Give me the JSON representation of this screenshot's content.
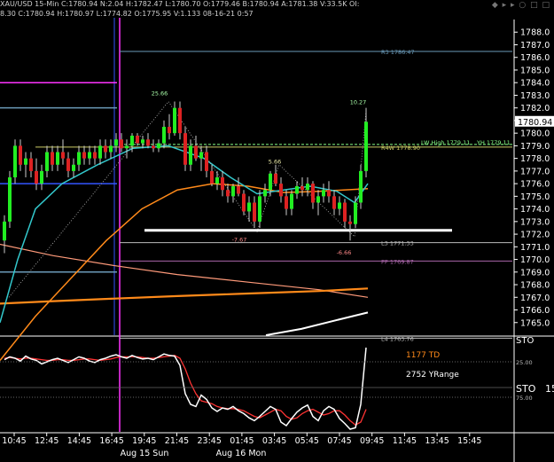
{
  "header": {
    "line1": "XAU/USD  15-Min  C:1780.94  N:2.04  H:1782.47  L:1780.70  O:1779.46  B:1780.94  A:1781.38  V:33.5K  OI:",
    "line2": "8.30  C:1780.94  H:1780.97  L:1774.82  O:1775.95  V:1.133  08-16-21  0:57"
  },
  "toolbar_glyphs": "◆ ▸ ▸ ○ □ □",
  "colors": {
    "bg": "#000000",
    "axis": "#ffffff",
    "grid": "#444444",
    "bull": "#22ee22",
    "bear": "#dd2222",
    "wick": "#cccccc",
    "cyan": "#33c8cc",
    "orange": "#ff8a1a",
    "salmon": "#ff9a7a",
    "magenta": "#ff33ff",
    "blue": "#3355ff",
    "white": "#ffffff",
    "steelblue": "#6a9ab8",
    "violet": "#aa66aa",
    "red": "#ff3333"
  },
  "chart_data": {
    "type": "candlestick",
    "price_axis": {
      "min": 1764.0,
      "max": 1789.0,
      "ticks": [
        1788.0,
        1787.0,
        1786.0,
        1785.0,
        1784.0,
        1783.0,
        1782.0,
        1781.0,
        1780.0,
        1779.0,
        1778.0,
        1777.0,
        1776.0,
        1775.0,
        1774.0,
        1773.0,
        1772.0,
        1771.0,
        1770.0,
        1769.0,
        1768.0,
        1767.0,
        1766.0,
        1765.0
      ],
      "current_price": "1780.94"
    },
    "time_axis": [
      "10:45",
      "12:45",
      "14:45",
      "16:45",
      "19:45",
      "21:45",
      "23:45",
      "01:45",
      "03:45",
      "05:45",
      "07:45",
      "09:45",
      "11:45",
      "13:45",
      "15:45"
    ],
    "date_labels": [
      "Aug 15 Sun",
      "Aug 16 Mon"
    ],
    "pivot_levels": [
      {
        "label": "R3 1786.47",
        "price": 1786.47
      },
      {
        "label": "R4W 1778.90",
        "price": 1778.9
      },
      {
        "label": "LW High 1779.11",
        "price": 1779.11
      },
      {
        "label": "YH 1779.11",
        "price": 1779.11
      },
      {
        "label": "L3 1771.33",
        "price": 1771.33
      },
      {
        "label": "PP 1769.87",
        "price": 1769.87
      },
      {
        "label": "L4 1763.76",
        "price": 1763.76
      }
    ],
    "swing_labels": [
      {
        "text": "25.66",
        "price": 1783.0
      },
      {
        "text": "10.27",
        "price": 1782.3
      },
      {
        "text": "5.66",
        "price": 1777.6
      },
      {
        "text": "-7.67",
        "price": 1771.4
      },
      {
        "text": "-6.66",
        "price": 1770.4
      }
    ],
    "candles": [
      [
        1771.5,
        1773.5,
        1770.5,
        1773.0
      ],
      [
        1773.0,
        1777.0,
        1772.5,
        1776.5
      ],
      [
        1776.5,
        1779.5,
        1776.0,
        1779.0
      ],
      [
        1779.0,
        1779.5,
        1777.0,
        1777.5
      ],
      [
        1777.5,
        1778.5,
        1776.5,
        1778.0
      ],
      [
        1778.0,
        1778.5,
        1776.5,
        1777.0
      ],
      [
        1777.0,
        1778.0,
        1775.5,
        1776.0
      ],
      [
        1776.0,
        1777.5,
        1775.5,
        1777.0
      ],
      [
        1777.0,
        1779.0,
        1776.5,
        1778.5
      ],
      [
        1778.5,
        1779.0,
        1777.0,
        1777.5
      ],
      [
        1777.5,
        1779.0,
        1777.0,
        1778.5
      ],
      [
        1778.5,
        1779.5,
        1777.5,
        1778.0
      ],
      [
        1778.0,
        1778.5,
        1776.5,
        1777.0
      ],
      [
        1777.0,
        1778.0,
        1776.5,
        1777.5
      ],
      [
        1777.5,
        1779.0,
        1777.0,
        1778.5
      ],
      [
        1778.5,
        1779.0,
        1777.5,
        1778.0
      ],
      [
        1778.0,
        1779.0,
        1777.5,
        1778.5
      ],
      [
        1778.5,
        1779.0,
        1777.5,
        1778.0
      ],
      [
        1778.0,
        1779.5,
        1777.5,
        1779.0
      ],
      [
        1779.0,
        1779.5,
        1778.0,
        1778.5
      ],
      [
        1778.5,
        1779.5,
        1778.0,
        1779.0
      ],
      [
        1779.0,
        1780.0,
        1778.5,
        1779.5
      ],
      [
        1779.5,
        1780.0,
        1778.5,
        1778.8
      ],
      [
        1778.8,
        1779.5,
        1778.0,
        1779.0
      ],
      [
        1779.0,
        1780.0,
        1778.5,
        1779.8
      ],
      [
        1779.8,
        1780.0,
        1779.0,
        1779.2
      ],
      [
        1779.2,
        1779.8,
        1778.8,
        1779.5
      ],
      [
        1779.5,
        1780.0,
        1778.8,
        1779.0
      ],
      [
        1779.0,
        1779.5,
        1778.5,
        1778.8
      ],
      [
        1778.8,
        1779.5,
        1778.5,
        1779.2
      ],
      [
        1779.2,
        1781.0,
        1778.8,
        1780.5
      ],
      [
        1780.5,
        1781.5,
        1779.5,
        1780.0
      ],
      [
        1780.0,
        1782.5,
        1779.8,
        1782.0
      ],
      [
        1782.0,
        1782.5,
        1779.5,
        1780.0
      ],
      [
        1780.0,
        1780.5,
        1777.0,
        1777.5
      ],
      [
        1777.5,
        1779.5,
        1777.0,
        1779.0
      ],
      [
        1779.0,
        1779.8,
        1777.8,
        1778.0
      ],
      [
        1778.0,
        1779.0,
        1777.0,
        1778.5
      ],
      [
        1778.5,
        1779.0,
        1776.5,
        1777.0
      ],
      [
        1777.0,
        1777.5,
        1775.8,
        1776.0
      ],
      [
        1776.0,
        1777.0,
        1775.5,
        1776.5
      ],
      [
        1776.5,
        1777.0,
        1775.0,
        1775.5
      ],
      [
        1775.5,
        1776.0,
        1774.5,
        1775.0
      ],
      [
        1775.0,
        1776.0,
        1774.5,
        1775.8
      ],
      [
        1775.8,
        1776.5,
        1775.0,
        1775.2
      ],
      [
        1775.2,
        1775.5,
        1773.5,
        1773.8
      ],
      [
        1773.8,
        1775.0,
        1773.0,
        1774.5
      ],
      [
        1774.5,
        1775.0,
        1772.5,
        1773.0
      ],
      [
        1773.0,
        1775.5,
        1772.5,
        1775.0
      ],
      [
        1775.0,
        1776.0,
        1774.5,
        1775.5
      ],
      [
        1775.5,
        1777.0,
        1775.0,
        1776.8
      ],
      [
        1776.8,
        1777.5,
        1775.8,
        1776.0
      ],
      [
        1776.0,
        1776.5,
        1774.5,
        1775.0
      ],
      [
        1775.0,
        1775.5,
        1773.5,
        1774.0
      ],
      [
        1774.0,
        1775.5,
        1773.5,
        1775.2
      ],
      [
        1775.2,
        1776.2,
        1774.8,
        1775.8
      ],
      [
        1775.8,
        1776.5,
        1775.0,
        1775.5
      ],
      [
        1775.5,
        1776.5,
        1775.0,
        1776.0
      ],
      [
        1776.0,
        1776.2,
        1774.0,
        1774.5
      ],
      [
        1774.5,
        1775.5,
        1773.5,
        1775.0
      ],
      [
        1775.0,
        1776.0,
        1774.5,
        1775.5
      ],
      [
        1775.5,
        1776.2,
        1774.5,
        1775.0
      ],
      [
        1775.0,
        1775.5,
        1773.5,
        1774.0
      ],
      [
        1774.0,
        1775.0,
        1773.5,
        1774.5
      ],
      [
        1774.5,
        1774.8,
        1772.5,
        1773.0
      ],
      [
        1773.0,
        1773.5,
        1771.5,
        1772.8
      ],
      [
        1772.8,
        1775.0,
        1772.5,
        1774.5
      ],
      [
        1774.5,
        1777.5,
        1774.0,
        1777.0
      ],
      [
        1777.0,
        1782.0,
        1776.5,
        1780.9
      ]
    ],
    "indicator": {
      "name": "STO",
      "levels": [
        "25.00",
        "75.00"
      ],
      "labels": [
        "1177 TD",
        "2752 YRange",
        "STO",
        "15"
      ],
      "fast": [
        78,
        82,
        80,
        76,
        83,
        79,
        77,
        72,
        75,
        78,
        80,
        77,
        74,
        78,
        82,
        80,
        76,
        74,
        78,
        80,
        83,
        85,
        82,
        80,
        84,
        81,
        79,
        80,
        78,
        82,
        86,
        84,
        83,
        70,
        30,
        15,
        12,
        28,
        22,
        10,
        5,
        10,
        8,
        12,
        6,
        2,
        -4,
        -8,
        -2,
        5,
        12,
        8,
        -10,
        -15,
        -5,
        4,
        10,
        14,
        -2,
        -8,
        6,
        12,
        8,
        -5,
        -12,
        -20,
        -18,
        15,
        95
      ],
      "slow": [
        80,
        81,
        80,
        79,
        80,
        80,
        79,
        78,
        77,
        77,
        78,
        78,
        77,
        77,
        78,
        79,
        79,
        78,
        77,
        78,
        79,
        81,
        82,
        82,
        82,
        82,
        81,
        80,
        80,
        81,
        82,
        83,
        84,
        80,
        65,
        45,
        30,
        20,
        18,
        16,
        12,
        10,
        9,
        9,
        8,
        6,
        2,
        -2,
        -4,
        0,
        4,
        8,
        6,
        -2,
        -6,
        -4,
        2,
        6,
        8,
        4,
        0,
        2,
        6,
        6,
        0,
        -8,
        -14,
        -10,
        8
      ]
    }
  }
}
